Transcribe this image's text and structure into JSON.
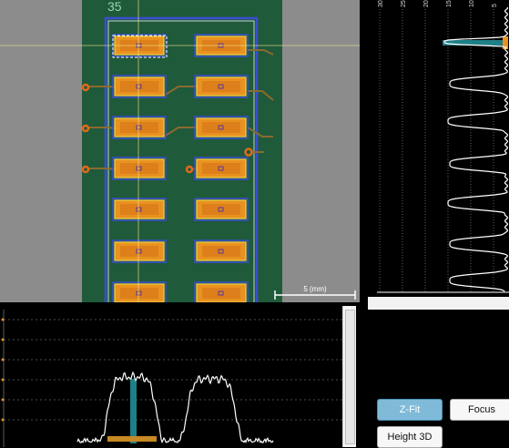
{
  "image_view": {
    "board_label": "35",
    "scale_bar_label": "5 (mm)",
    "colors": {
      "background": "#8c8c8c",
      "pcb": "#1f5a3a",
      "pad": "#e8921f",
      "trace": "#8b6a2f",
      "via": "#e26a1a",
      "outline_blue": "#3a4ed0",
      "crosshair": "#f0e68c"
    }
  },
  "right_profile": {
    "tick_labels": [
      "30",
      "25",
      "20",
      "15",
      "10",
      "5"
    ],
    "colors": {
      "curve": "#ffffff",
      "marker": "#1f7f86",
      "accent": "#e8921f"
    }
  },
  "bottom_profile": {
    "colors": {
      "curve": "#ffffff",
      "grid": "#666666",
      "marker": "#1f7f86",
      "accent": "#e8921f"
    }
  },
  "controls": {
    "zfit_label": "Z-Fit",
    "focus_label": "Focus",
    "height3d_label": "Height 3D"
  }
}
